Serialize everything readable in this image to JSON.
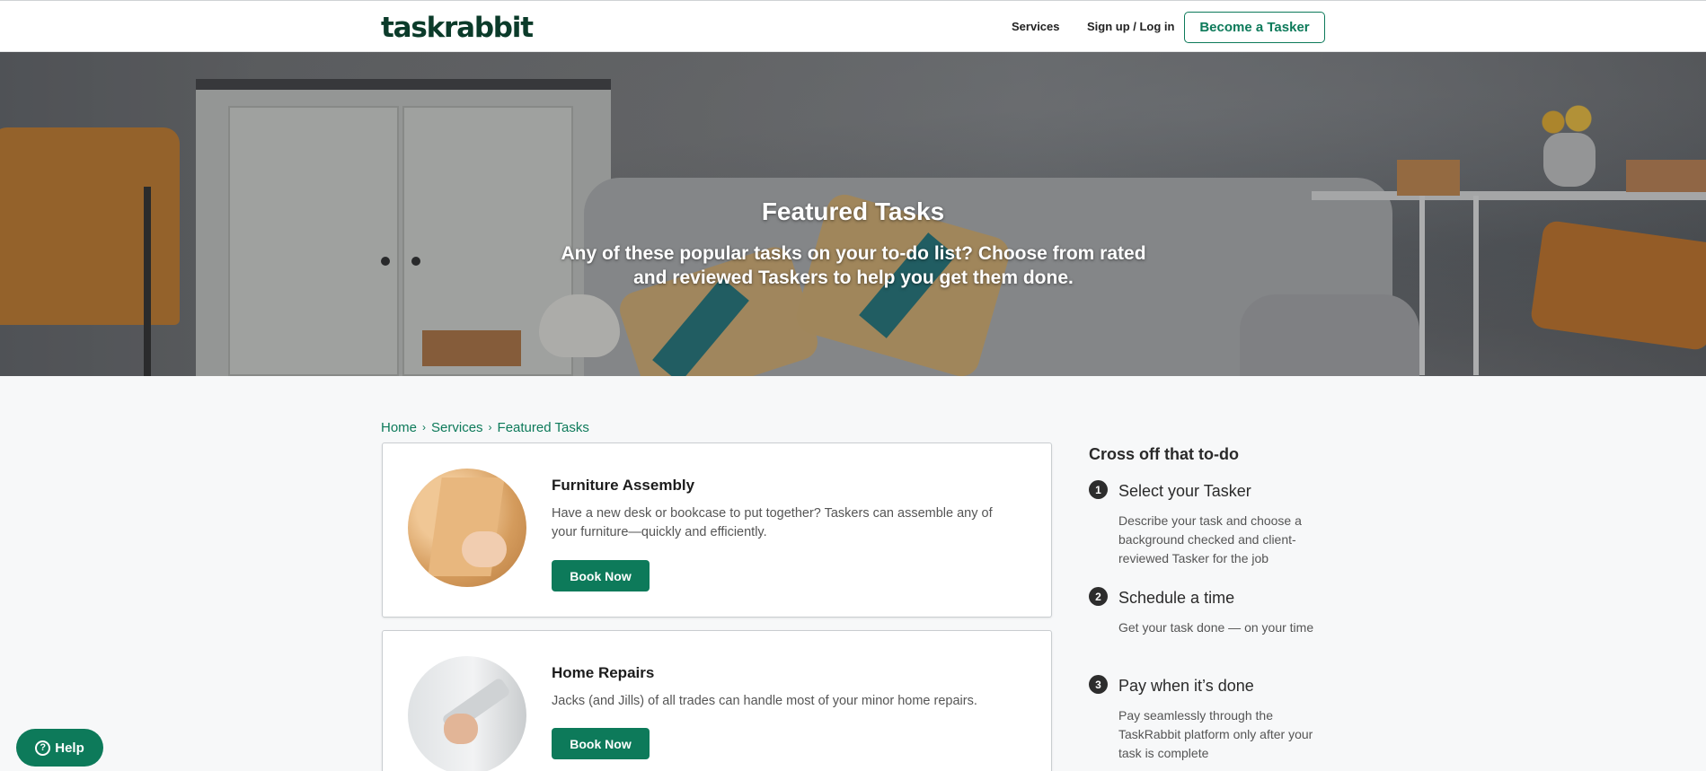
{
  "header": {
    "logo": "taskrabbit",
    "nav_services": "Services",
    "nav_signup": "Sign up / Log in",
    "become_tasker": "Become a Tasker"
  },
  "hero": {
    "title": "Featured Tasks",
    "subtitle": "Any of these popular tasks on your to-do list? Choose from rated and reviewed Taskers to help you get them done."
  },
  "breadcrumb": {
    "items": [
      "Home",
      "Services",
      "Featured Tasks"
    ],
    "separator": "›"
  },
  "tasks": [
    {
      "title": "Furniture Assembly",
      "description": "Have a new desk or bookcase to put together? Taskers can assemble any of your furniture—quickly and efficiently.",
      "button": "Book Now",
      "image_icon": "furniture-photo"
    },
    {
      "title": "Home Repairs",
      "description": "Jacks (and Jills) of all trades can handle most of your minor home repairs.",
      "button": "Book Now",
      "image_icon": "repair-photo"
    }
  ],
  "sidebar": {
    "title": "Cross off that to-do",
    "steps": [
      {
        "number": "1",
        "title": "Select your Tasker",
        "description": "Describe your task and choose a background checked and client-reviewed Tasker for the job"
      },
      {
        "number": "2",
        "title": "Schedule a time",
        "description": "Get your task done — on your time"
      },
      {
        "number": "3",
        "title": "Pay when it’s done",
        "description": "Pay seamlessly through the TaskRabbit platform only after your task is complete"
      }
    ]
  },
  "help": {
    "label": "Help",
    "icon": "?"
  },
  "colors": {
    "brand_green": "#0d7a5a",
    "logo_dark_green": "#0b3b2a",
    "page_background": "#f7f8f9"
  }
}
